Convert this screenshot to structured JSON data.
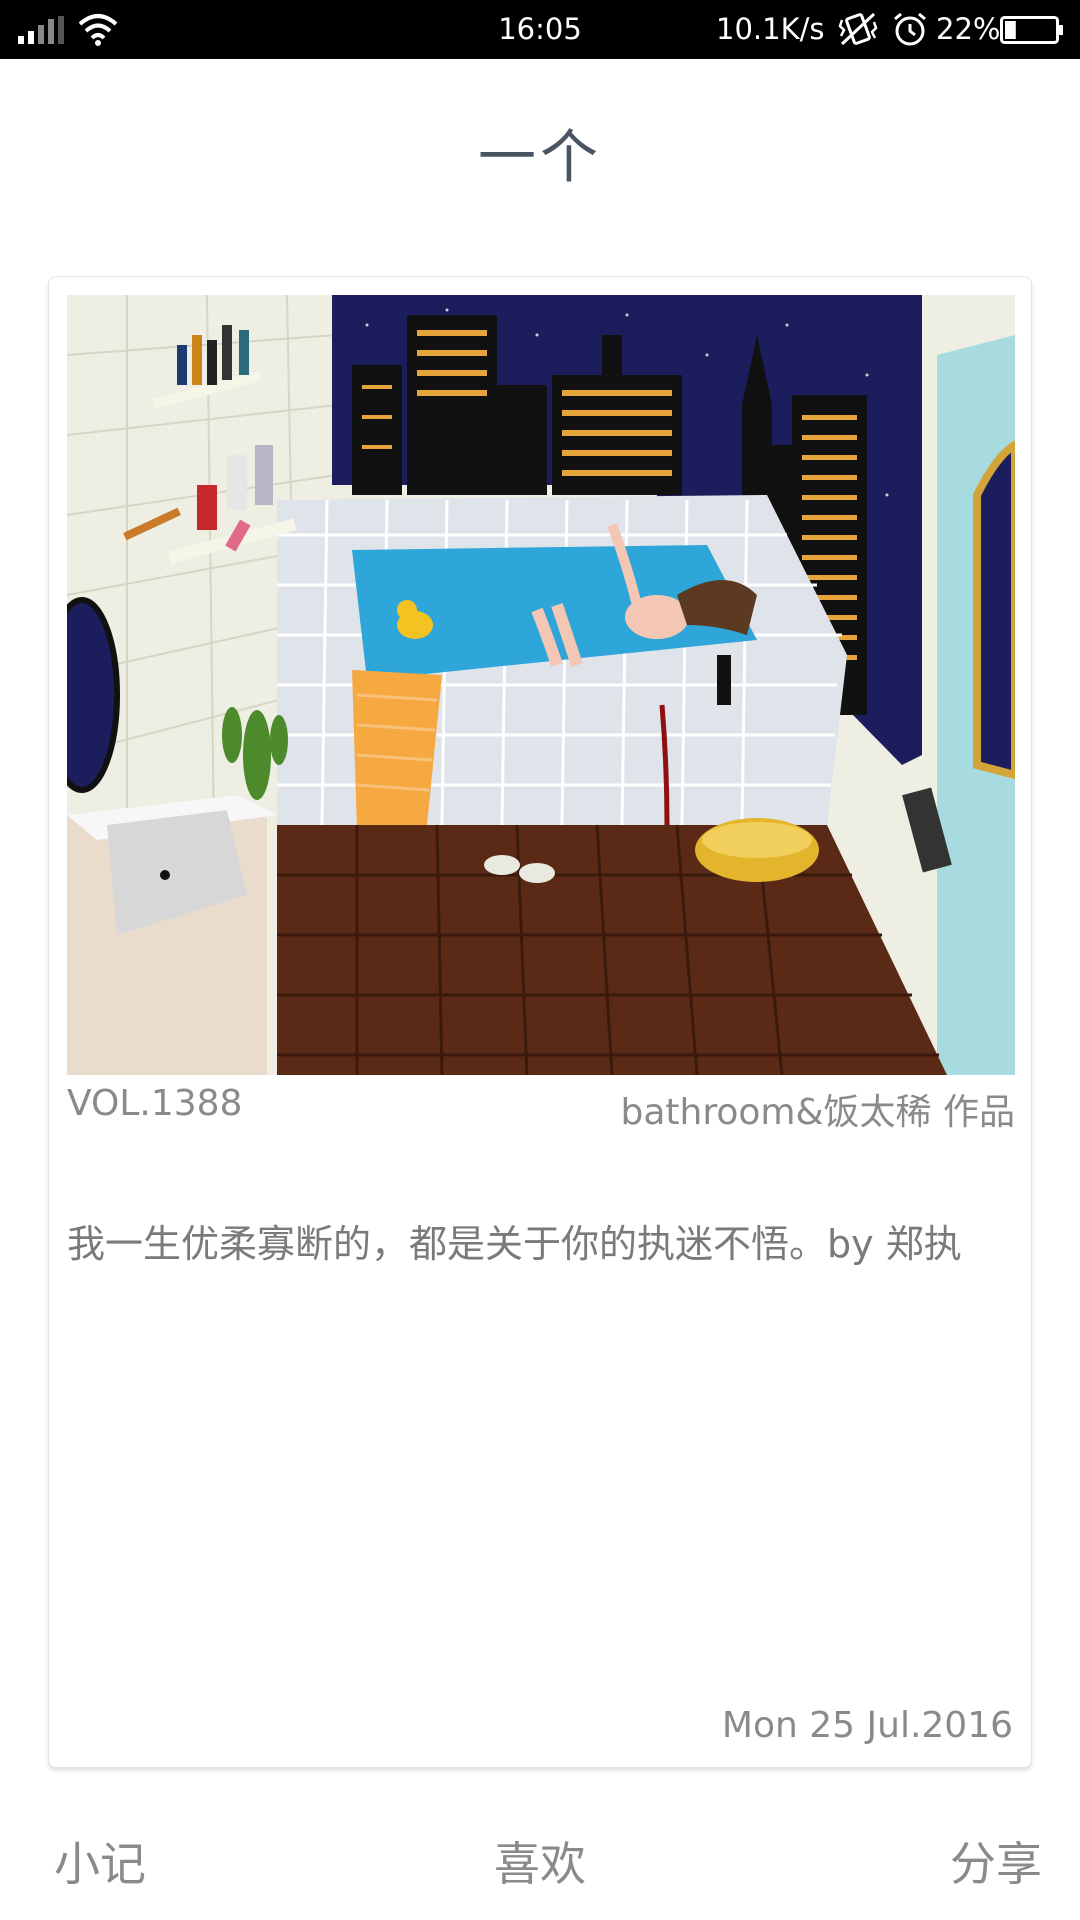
{
  "status_bar": {
    "time": "16:05",
    "network_speed": "10.1K/s",
    "battery_percent": "22%",
    "battery_level": 0.22,
    "icons": [
      "signal-icon",
      "wifi-icon",
      "vibrate-off-icon",
      "alarm-icon",
      "battery-icon"
    ]
  },
  "header": {
    "title": "一个"
  },
  "card": {
    "image_icon": "bathroom-illustration",
    "volume": "VOL.1388",
    "artist": "bathroom&饭太稀 作品",
    "quote": "我一生优柔寡断的，都是关于你的执迷不悟。by 郑执",
    "date": "Mon 25 Jul.2016"
  },
  "bottom_bar": {
    "note_label": "小记",
    "like_label": "喜欢",
    "share_label": "分享"
  },
  "colors": {
    "status_bar_bg": "#000000",
    "title_text": "#4a5563",
    "meta_text": "#8a8a8a",
    "night_sky": "#1b1d5c",
    "water": "#2ea6d9",
    "floor": "#5a2a17"
  }
}
